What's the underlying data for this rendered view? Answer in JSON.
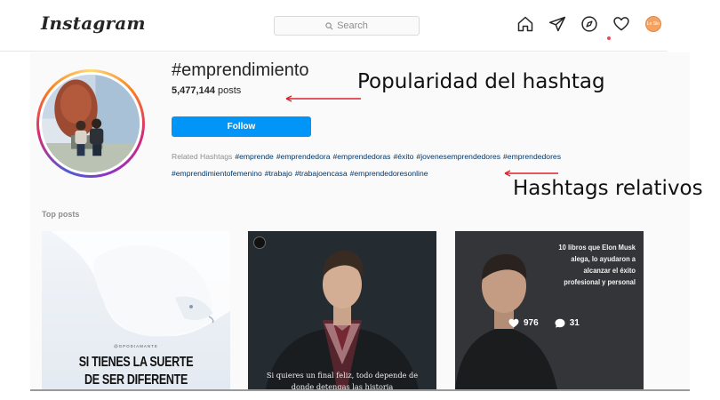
{
  "app": {
    "logo_text": "Instagram"
  },
  "header": {
    "search_placeholder": "Search",
    "nav_icons": [
      "home-icon",
      "direct-icon",
      "explore-icon",
      "activity-icon",
      "profile-avatar"
    ],
    "avatar_initials": "Le Slo"
  },
  "hashtag": {
    "title": "#emprendimiento",
    "post_count": "5,477,144",
    "post_count_suffix": " posts",
    "follow_label": "Follow"
  },
  "related": {
    "label": "Related Hashtags",
    "tags": [
      "#emprende",
      "#emprendedora",
      "#emprendedoras",
      "#éxito",
      "#jovenesemprendedores",
      "#emprendedores",
      "#emprendimientofemenino",
      "#trabajo",
      "#trabajoencasa",
      "#emprendedoresonline"
    ]
  },
  "top_posts": {
    "title": "Top posts",
    "posts": [
      {
        "small_text": "@GPODIAMANTE",
        "line1": "SI TIENES LA SUERTE",
        "line2": "DE SER DIFERENTE"
      },
      {
        "caption": "Si quieres un final feliz, todo depende de donde detengas las historia"
      },
      {
        "text": "10 libros que Elon Musk alega, lo ayudaron a alcanzar el éxito profesional y personal",
        "likes": "976",
        "comments": "31"
      }
    ]
  },
  "annotations": {
    "popularity": "Popularidad del hashtag",
    "related": "Hashtags relativos"
  },
  "colors": {
    "follow_button": "#0095f6",
    "hashtag_link": "#00376b",
    "annotation_arrow": "#d9232d",
    "activity_dot": "#ed4956"
  }
}
